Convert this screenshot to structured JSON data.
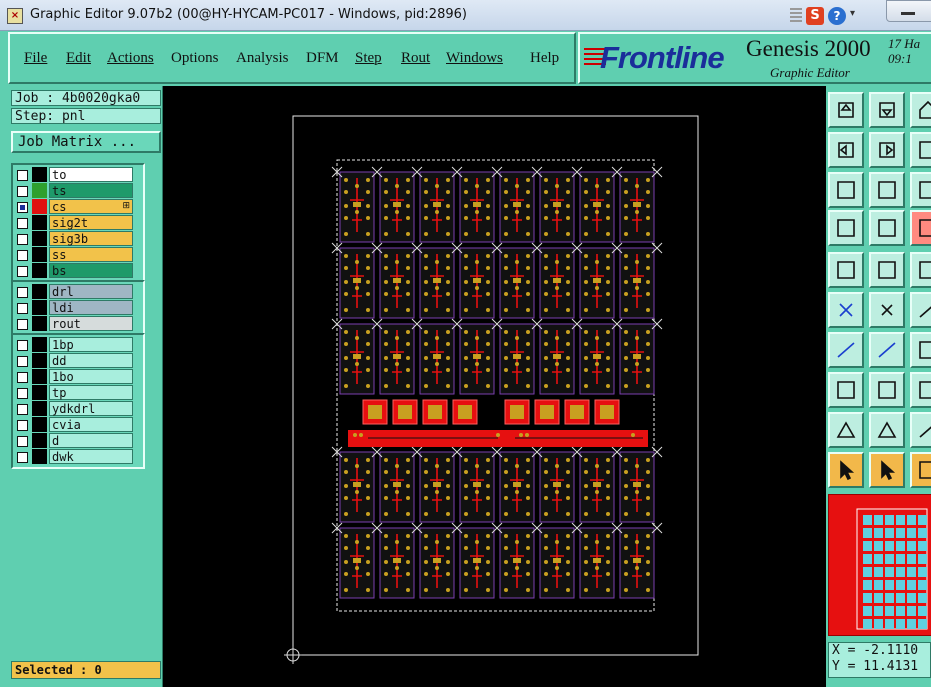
{
  "window": {
    "title": "Graphic Editor 9.07b2 (00@HY-HYCAM-PC017 - Windows, pid:2896)",
    "app_icon": "x-window-icon",
    "tray_icons": [
      "sogou-s-icon",
      "help-icon",
      "dropdown-icon"
    ]
  },
  "menubar": {
    "items": [
      {
        "label": "File",
        "underlined": true
      },
      {
        "label": "Edit",
        "underlined": true
      },
      {
        "label": "Actions",
        "underlined": true
      },
      {
        "label": "Options",
        "underlined": false
      },
      {
        "label": "Analysis",
        "underlined": false
      },
      {
        "label": "DFM",
        "underlined": false
      },
      {
        "label": "Step",
        "underlined": true
      },
      {
        "label": "Rout",
        "underlined": true
      },
      {
        "label": "Windows",
        "underlined": true
      },
      {
        "label": "Help",
        "underlined": false
      }
    ]
  },
  "brand": {
    "logo": "Frontline",
    "product": "Genesis 2000",
    "subtitle": "Graphic Editor",
    "date_line1": "17 Ha",
    "date_line2": "09:1"
  },
  "job": {
    "job_label": "Job : 4b0020gka0",
    "step_label": "Step: pnl",
    "job_matrix_button": "Job Matrix ..."
  },
  "layer_groups": [
    [
      {
        "name": "to",
        "color": "#ffffff",
        "swatch": "#000000",
        "checked": false
      },
      {
        "name": "ts",
        "color": "#1e9a6a",
        "swatch": "#2ea02e",
        "checked": false
      },
      {
        "name": "cs",
        "color": "#f2c24a",
        "swatch": "#e01010",
        "checked": true,
        "marker": "⊞"
      },
      {
        "name": "sig2t",
        "color": "#f2c24a",
        "swatch": "#000000",
        "checked": false
      },
      {
        "name": "sig3b",
        "color": "#f2c24a",
        "swatch": "#000000",
        "checked": false
      },
      {
        "name": "ss",
        "color": "#f2c24a",
        "swatch": "#000000",
        "checked": false
      },
      {
        "name": "bs",
        "color": "#1e9a6a",
        "swatch": "#000000",
        "checked": false
      }
    ],
    [
      {
        "name": "drl",
        "color": "#9fb6c4",
        "swatch": "#000000",
        "checked": false
      },
      {
        "name": "ldi",
        "color": "#9fb6c4",
        "swatch": "#000000",
        "checked": false
      },
      {
        "name": "rout",
        "color": "#d6dcdc",
        "swatch": "#000000",
        "checked": false
      }
    ],
    [
      {
        "name": "1bp",
        "color": "#a8eedd",
        "swatch": "#000000",
        "checked": false
      },
      {
        "name": "dd",
        "color": "#a8eedd",
        "swatch": "#000000",
        "checked": false
      },
      {
        "name": "1bo",
        "color": "#a8eedd",
        "swatch": "#000000",
        "checked": false
      },
      {
        "name": "tp",
        "color": "#a8eedd",
        "swatch": "#000000",
        "checked": false
      },
      {
        "name": "ydkdrl",
        "color": "#a8eedd",
        "swatch": "#000000",
        "checked": false
      },
      {
        "name": "cvia",
        "color": "#a8eedd",
        "swatch": "#000000",
        "checked": false
      },
      {
        "name": "d",
        "color": "#a8eedd",
        "swatch": "#000000",
        "checked": false
      },
      {
        "name": "dwk",
        "color": "#a8eedd",
        "swatch": "#000000",
        "checked": false
      }
    ]
  ],
  "status": {
    "selected": "Selected : 0"
  },
  "coords": {
    "x": "X = -2.1110",
    "y": "Y = 11.4131"
  },
  "panel": {
    "grid_columns": 8,
    "upper_rows": 3,
    "lower_rows": 2,
    "coupons_per_group": 4,
    "board_color": "#e61010",
    "pad_color": "#c8a020",
    "outline_color": "#7a3fb0"
  },
  "toolbar": [
    [
      "move-up-icon",
      "move-down-icon",
      "home-icon"
    ],
    [
      "move-left-icon",
      "move-right-icon",
      "undo-icon"
    ],
    [
      "fit-screen-icon",
      "zoom-fit-icon",
      "scale-icon"
    ],
    [
      "measure-icon",
      "grid-icon",
      "snap-icon"
    ],
    [
      "feature-select-icon",
      "area-select-icon",
      "ruler-icon"
    ],
    [
      "net-icon",
      "delete-icon",
      "line-icon"
    ],
    [
      "draw-line-icon",
      "draw-arrow-icon",
      "stretch-icon"
    ],
    [
      "pad-icon",
      "segment-icon",
      "cross-icon"
    ],
    [
      "polygon-icon",
      "triangle-icon",
      "outline-icon"
    ],
    [
      "pointer-icon",
      "pointer-box-icon",
      "rotate-icon"
    ]
  ]
}
